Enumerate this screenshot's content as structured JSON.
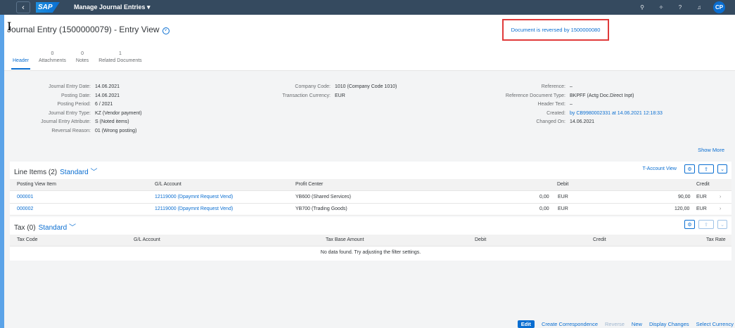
{
  "shell": {
    "back_icon": "chevron-left-icon",
    "logo": "SAP",
    "app_title": "Manage Journal Entries ▾",
    "user_initials": "CP"
  },
  "header": {
    "title": "Journal Entry (1500000079) - Entry View",
    "reversal_message": "Document is reversed by 1500000080",
    "tabs": [
      {
        "count": "",
        "label": "Header"
      },
      {
        "count": "0",
        "label": "Attachments"
      },
      {
        "count": "0",
        "label": "Notes"
      },
      {
        "count": "1",
        "label": "Related Documents"
      }
    ]
  },
  "facets": {
    "col1": [
      {
        "label": "Journal Entry Date:",
        "value": "14.06.2021"
      },
      {
        "label": "Posting Date:",
        "value": "14.06.2021"
      },
      {
        "label": "Posting Period:",
        "value": "6 / 2021"
      },
      {
        "label": "Journal Entry Type:",
        "value": "KZ (Vendor payment)"
      },
      {
        "label": "Journal Entry Attribute:",
        "value": "S (Noted items)"
      },
      {
        "label": "Reversal Reason:",
        "value": "01 (Wrong posting)"
      }
    ],
    "col2": [
      {
        "label": "Company Code:",
        "value": "1010 (Company Code 1010)"
      },
      {
        "label": "Transaction Currency:",
        "value": "EUR"
      }
    ],
    "col3": [
      {
        "label": "Reference:",
        "value": "–"
      },
      {
        "label": "Reference Document Type:",
        "value": "BKPFF (Actg Doc.Direct Inpt)"
      },
      {
        "label": "Header Text:",
        "value": "–"
      },
      {
        "label": "Created:",
        "value": "by CB9980002331 at 14.06.2021 12:18:33"
      },
      {
        "label": "Changed On:",
        "value": "14.06.2021"
      }
    ],
    "show_more": "Show More"
  },
  "line_items": {
    "title": "Line Items (2)",
    "variant": "Standard",
    "t_account_view": "T-Account View",
    "columns": [
      "Posting View Item",
      "G/L Account",
      "Profit Center",
      "Debit",
      "Credit"
    ],
    "rows": [
      {
        "item": "000001",
        "gl": "12119000 (Dpaymnt Request Vend)",
        "pc": "YB600 (Shared Services)",
        "debit": "0,00",
        "debit_cur": "EUR",
        "credit": "90,00",
        "credit_cur": "EUR"
      },
      {
        "item": "000002",
        "gl": "12119000 (Dpaymnt Request Vend)",
        "pc": "YB700 (Trading Goods)",
        "debit": "0,00",
        "debit_cur": "EUR",
        "credit": "120,00",
        "credit_cur": "EUR"
      }
    ]
  },
  "tax": {
    "title": "Tax (0)",
    "variant": "Standard",
    "columns": [
      "Tax Code",
      "G/L Account",
      "Tax Base Amount",
      "Debit",
      "Credit",
      "Tax Rate"
    ],
    "no_data": "No data found. Try adjusting the filter settings."
  },
  "footer": {
    "edit": "Edit",
    "create_correspondence": "Create Correspondence",
    "reverse": "Reverse",
    "new": "New",
    "display_changes": "Display Changes",
    "select_currency": "Select Currency"
  }
}
